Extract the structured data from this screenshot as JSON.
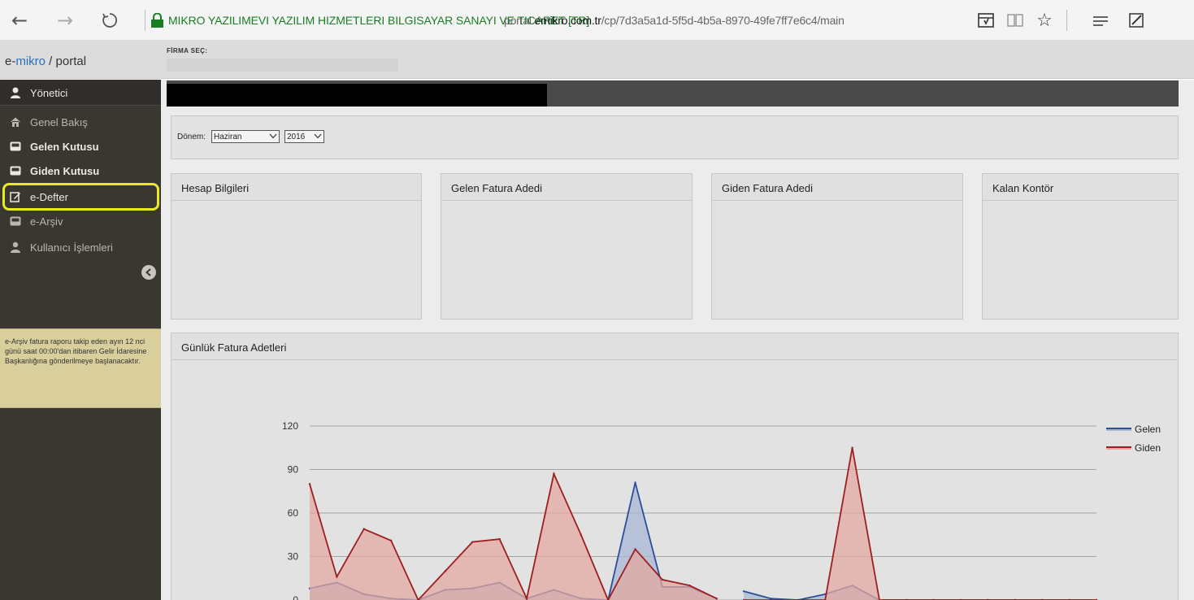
{
  "browser": {
    "site_identity": "MIKRO YAZILIMEVI YAZILIM HIZMETLERI BILGISAYAR SANAYI VE TICARET [TR]",
    "url_prefix": "portal.",
    "url_domain": "emikro.com.tr",
    "url_path": "/cp/7d3a5a1d-5f5d-4b5a-8970-49fe7ff7e6c4/main",
    "icons": [
      "back-arrow-icon",
      "forward-arrow-icon",
      "refresh-icon",
      "lock-icon",
      "reading-list-icon",
      "book-icon",
      "star-icon",
      "hub-icon",
      "web-note-icon"
    ]
  },
  "header": {
    "brand_prefix": "e-",
    "brand_highlight": "mikro",
    "brand_suffix": " / portal",
    "firma_label": "FİRMA SEÇ:"
  },
  "sidebar": {
    "user": "Yönetici",
    "items": [
      {
        "label": "Genel Bakış",
        "icon": "home-icon"
      },
      {
        "label": "Gelen Kutusu",
        "icon": "inbox-icon"
      },
      {
        "label": "Giden Kutusu",
        "icon": "outbox-icon"
      },
      {
        "label": "e-Defter",
        "icon": "edit-icon"
      },
      {
        "label": "e-Arşiv",
        "icon": "archive-icon"
      },
      {
        "label": "Kullanıcı İşlemleri",
        "icon": "users-icon"
      }
    ],
    "notice": "e-Arşiv fatura raporu takip eden ayın 12 nci günü saat 00:00'dan itibaren Gelir İdaresine Başkanlığına gönderilmeye başlanacaktır.",
    "highlight_color": "#e8ea23"
  },
  "period": {
    "label": "Dönem:",
    "month": "Haziran",
    "year": "2016"
  },
  "cards": [
    {
      "title": "Hesap Bilgileri"
    },
    {
      "title": "Gelen Fatura Adedi"
    },
    {
      "title": "Giden Fatura Adedi"
    },
    {
      "title": "Kalan Kontör"
    }
  ],
  "chart_panel_title": "Günlük Fatura Adetleri",
  "chart_data": {
    "type": "area",
    "title": "",
    "xlabel": "",
    "ylabel": "",
    "ylim": [
      0,
      120
    ],
    "yticks": [
      0,
      30,
      60,
      90,
      120
    ],
    "grid": true,
    "legend_position": "top-right",
    "x": [
      1,
      2,
      3,
      4,
      5,
      6,
      7,
      8,
      9,
      10,
      11,
      12,
      13,
      14,
      15,
      16,
      16.5,
      17,
      18,
      19,
      20,
      21,
      22,
      23,
      24,
      25,
      26,
      27,
      28,
      29,
      30
    ],
    "series": [
      {
        "name": "Gelen",
        "color": "#2b4d9a",
        "fill": "#a8b7d4",
        "values": [
          8,
          12,
          4,
          1,
          0,
          7,
          8,
          12,
          1,
          7,
          1,
          0,
          81,
          9,
          9,
          1,
          null,
          6,
          1,
          0,
          4,
          10,
          0,
          0,
          0,
          0,
          0,
          0,
          0,
          0,
          0
        ]
      },
      {
        "name": "Giden",
        "color": "#9e1e1e",
        "fill": "#e3a8a1",
        "values": [
          80,
          16,
          49,
          41,
          0,
          20,
          40,
          42,
          1,
          87,
          45,
          0,
          35,
          14,
          10,
          1,
          null,
          0,
          0,
          0,
          0,
          105,
          0,
          0,
          0,
          0,
          0,
          0,
          0,
          0,
          0
        ]
      }
    ]
  }
}
